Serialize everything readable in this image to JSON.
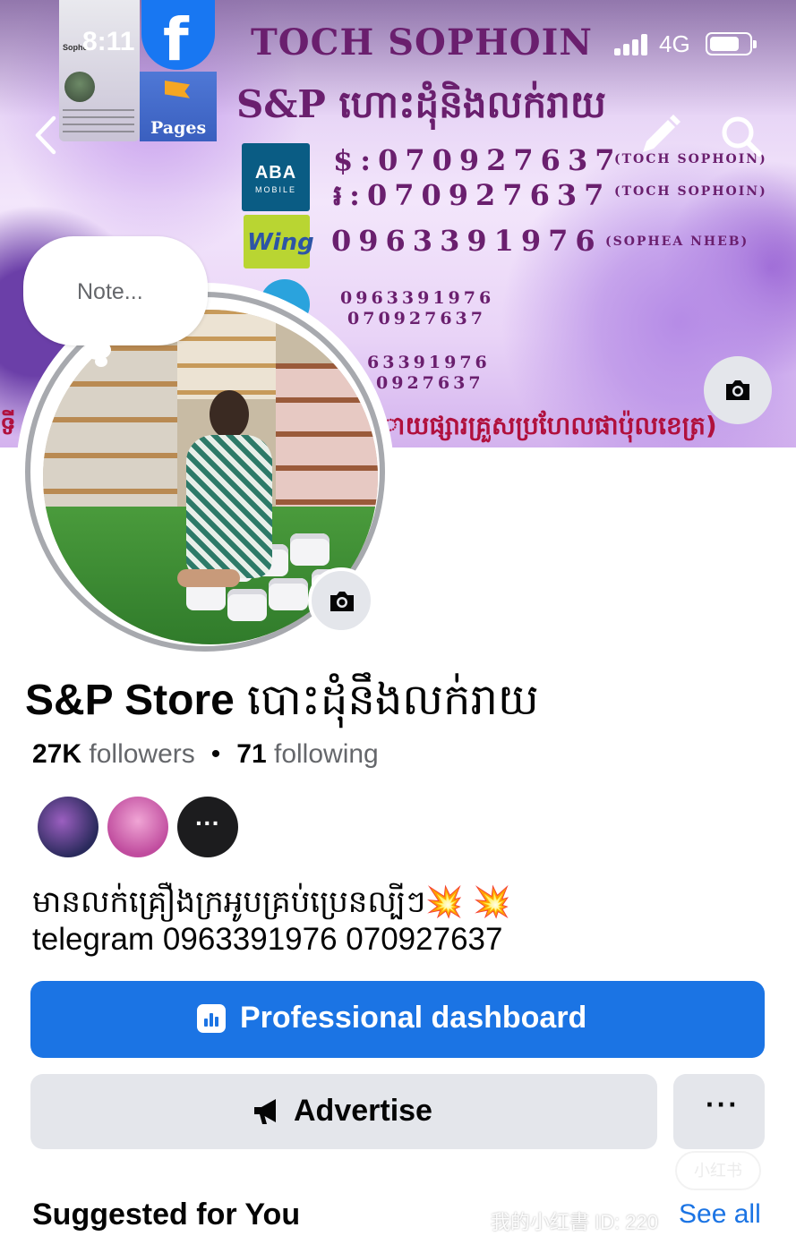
{
  "status_bar": {
    "time": "8:11",
    "network": "4G",
    "signal_bars": 4,
    "battery_level": 0.75
  },
  "cover": {
    "thumb_tile": {
      "text": "Sophe",
      "label": "Pages"
    },
    "title_line_1": "TOCH SOPHOIN",
    "title_line_2": "S&P ហោះដុំនិងលក់រាយ",
    "aba_logo": {
      "main": "ABA",
      "sub": "MOBILE"
    },
    "wing_logo": "Wing",
    "line_1": "$:070927637",
    "line_1_name": "(TOCH SOPHOIN)",
    "line_2": "៛:070927637",
    "line_2_name": "(TOCH SOPHOIN)",
    "line_3": "0963391976",
    "line_3_name": "(SOPHEA NHEB)",
    "line_4": "0963391976",
    "line_5": "070927637",
    "line_6": "63391976",
    "line_7": "0927637",
    "bottom_line": "ាយផ្សារគ្រួសប្រហែលផាប៉ុលខេត្រ)",
    "left_edge_text": "ទី"
  },
  "note": {
    "placeholder": "Note..."
  },
  "profile": {
    "name": "S&P Store",
    "name_khmer": "បោះដុំនឹងលក់រាយ",
    "followers_count": "27K",
    "followers_label": "followers",
    "separator": "•",
    "following_count": "71",
    "following_label": "following",
    "friends_more": "···",
    "bio_line_1": "មានលក់គ្រឿងក្រអូបគ្រប់ប្រេនល្បីៗ💥 💥",
    "bio_line_2": "telegram 0963391976 070927637"
  },
  "actions": {
    "primary_label": "Professional dashboard",
    "secondary_label": "Advertise",
    "more_label": "···"
  },
  "suggested": {
    "title": "Suggested for You",
    "see_all": "See all"
  },
  "watermark": {
    "oval": "小红书",
    "text": "我的小红書 ID: 220"
  },
  "colors": {
    "brand_blue": "#1b74e4",
    "secondary_gray": "#e4e6eb",
    "cover_text_purple": "#6a1f6e"
  },
  "icons": [
    "back-icon",
    "edit-icon",
    "search-icon",
    "camera-icon",
    "dashboard-icon",
    "megaphone-icon"
  ]
}
